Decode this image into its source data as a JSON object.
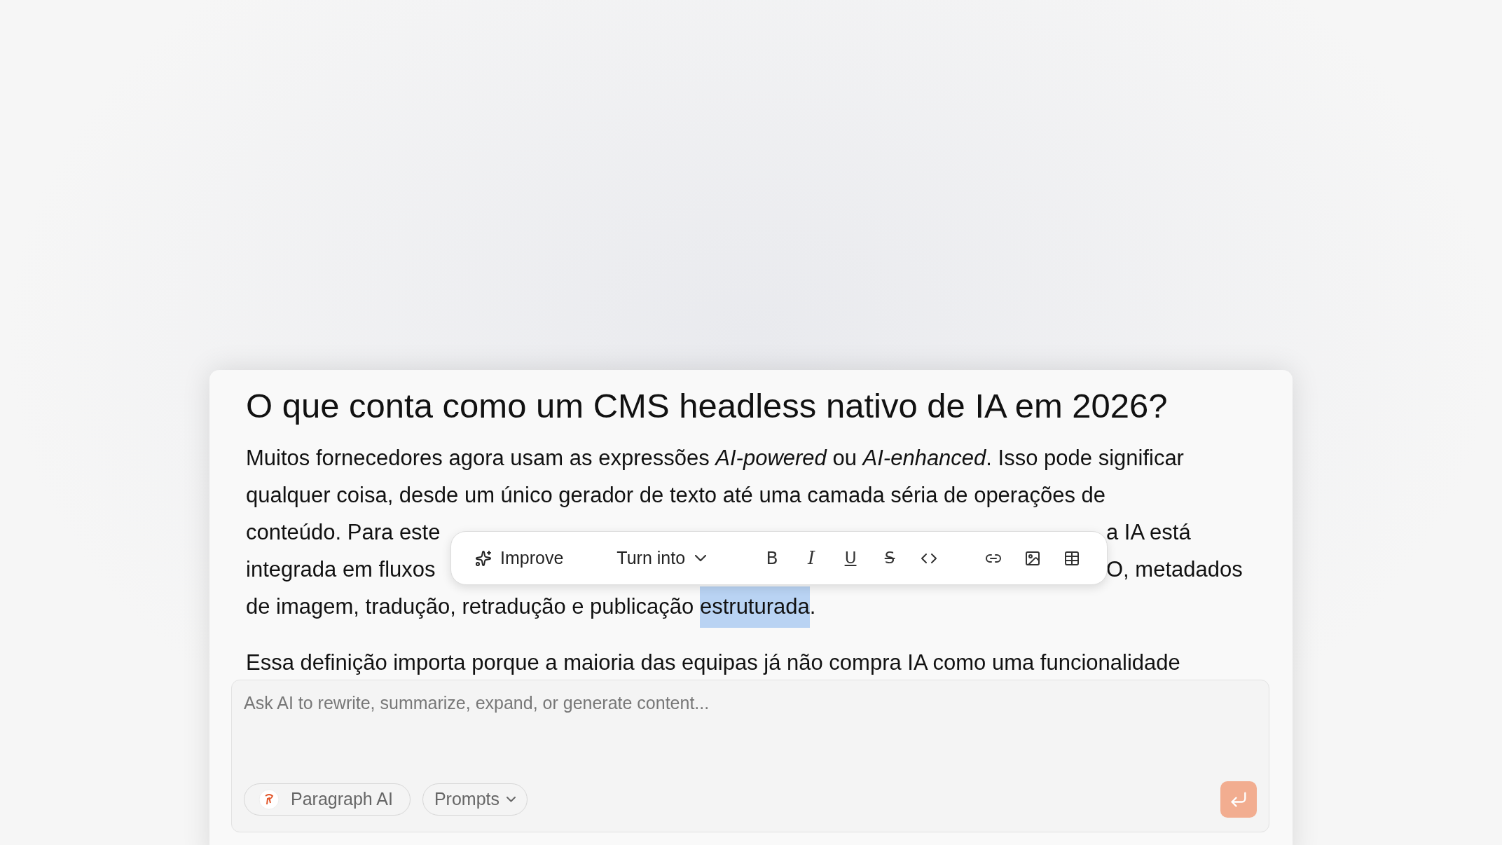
{
  "article": {
    "title": "O que conta como um CMS headless nativo de IA em 2026?",
    "lines": [
      {
        "kind": "full",
        "text": "Muitos fornecedores agora usam as expressões *AI-powered* ou *AI-enhanced*. Isso pode significar"
      },
      {
        "kind": "full",
        "text": "qualquer coisa, desde um único gerador de texto até uma camada séria de operações de"
      },
      {
        "kind": "split",
        "left": "conteúdo. Para este",
        "right": "a IA está"
      },
      {
        "kind": "split",
        "left": "integrada em fluxos",
        "right": "O, metadados"
      },
      {
        "kind": "selection",
        "before": "de imagem, tradução, retradução e publicação ",
        "selected": "estruturada",
        "after": "."
      }
    ],
    "next_paragraph": "Essa definição importa porque a maioria das equipas já não compra IA como uma funcionalidade"
  },
  "toolbar": {
    "improve": "Improve",
    "turn_into": "Turn into",
    "tools": [
      {
        "kind": "bold",
        "label": "B"
      },
      {
        "kind": "italic",
        "label": "I"
      },
      {
        "kind": "underline",
        "label": "U"
      },
      {
        "kind": "strike",
        "label": "S"
      },
      {
        "kind": "code"
      },
      {
        "kind": "link"
      },
      {
        "kind": "image"
      },
      {
        "kind": "table"
      }
    ]
  },
  "composer": {
    "placeholder": "Ask AI to rewrite, summarize, expand, or generate content...",
    "model": "Paragraph AI",
    "prompts": "Prompts"
  }
}
